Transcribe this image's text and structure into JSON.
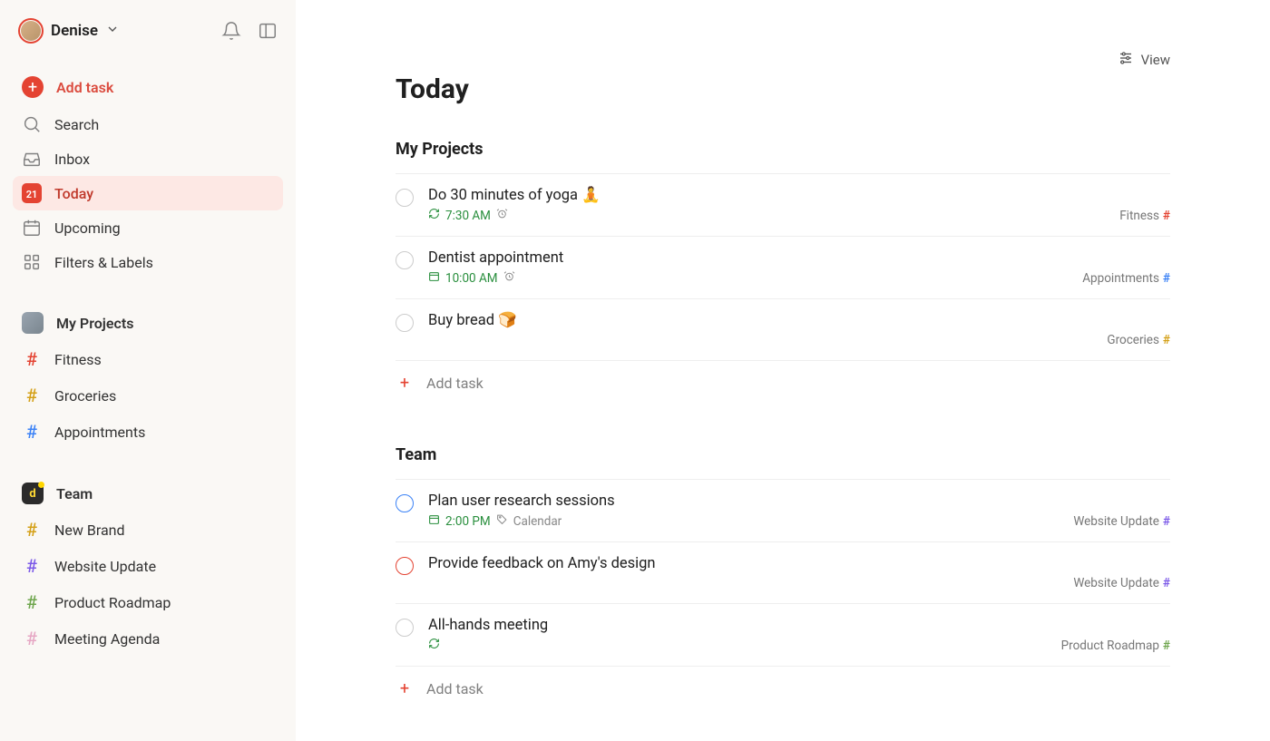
{
  "user": {
    "name": "Denise"
  },
  "sidebar": {
    "add_task_label": "Add task",
    "nav": {
      "search": "Search",
      "inbox": "Inbox",
      "today": "Today",
      "today_day": "21",
      "upcoming": "Upcoming",
      "filters": "Filters & Labels"
    },
    "my_projects": {
      "header": "My Projects",
      "items": [
        {
          "label": "Fitness",
          "color": "#e44332"
        },
        {
          "label": "Groceries",
          "color": "#d4a017"
        },
        {
          "label": "Appointments",
          "color": "#3b82f6"
        }
      ]
    },
    "team": {
      "header": "Team",
      "avatar_initial": "d",
      "items": [
        {
          "label": "New Brand",
          "color": "#d4a017"
        },
        {
          "label": "Website Update",
          "color": "#7c5ae8"
        },
        {
          "label": "Product Roadmap",
          "color": "#6fa64e"
        },
        {
          "label": "Meeting Agenda",
          "color": "#e6a7c4"
        }
      ]
    }
  },
  "main": {
    "view_label": "View",
    "title": "Today",
    "sections": [
      {
        "id": "my-projects",
        "title": "My Projects",
        "tasks": [
          {
            "title": "Do 30 minutes of yoga 🧘",
            "time": "7:30 AM",
            "recurring": true,
            "alarm": true,
            "project_label": "Fitness",
            "project_hash_color": "#e44332",
            "check": "grey"
          },
          {
            "title": "Dentist appointment",
            "time": "10:00 AM",
            "calendar": true,
            "alarm": true,
            "project_label": "Appointments",
            "project_hash_color": "#3b82f6",
            "check": "grey"
          },
          {
            "title": "Buy bread 🍞",
            "project_label": "Groceries",
            "project_hash_color": "#d4a017",
            "check": "grey"
          }
        ],
        "add_task_label": "Add task"
      },
      {
        "id": "team",
        "title": "Team",
        "tasks": [
          {
            "title": "Plan user research sessions",
            "time": "2:00 PM",
            "calendar": true,
            "tag_icon": true,
            "tag_text": "Calendar",
            "project_label": "Website Update",
            "project_hash_color": "#7c5ae8",
            "check": "blue"
          },
          {
            "title": "Provide feedback on Amy's design",
            "project_label": "Website Update",
            "project_hash_color": "#7c5ae8",
            "check": "orange-red"
          },
          {
            "title": "All-hands meeting",
            "recurring": true,
            "project_label": "Product Roadmap",
            "project_hash_color": "#6fa64e",
            "check": "grey"
          }
        ],
        "add_task_label": "Add task"
      }
    ]
  },
  "colors": {
    "accent": "#e44332",
    "sidebar_bg": "#faf8f5",
    "selected_bg": "#fde8e4",
    "meta_green": "#2a8f3e"
  }
}
